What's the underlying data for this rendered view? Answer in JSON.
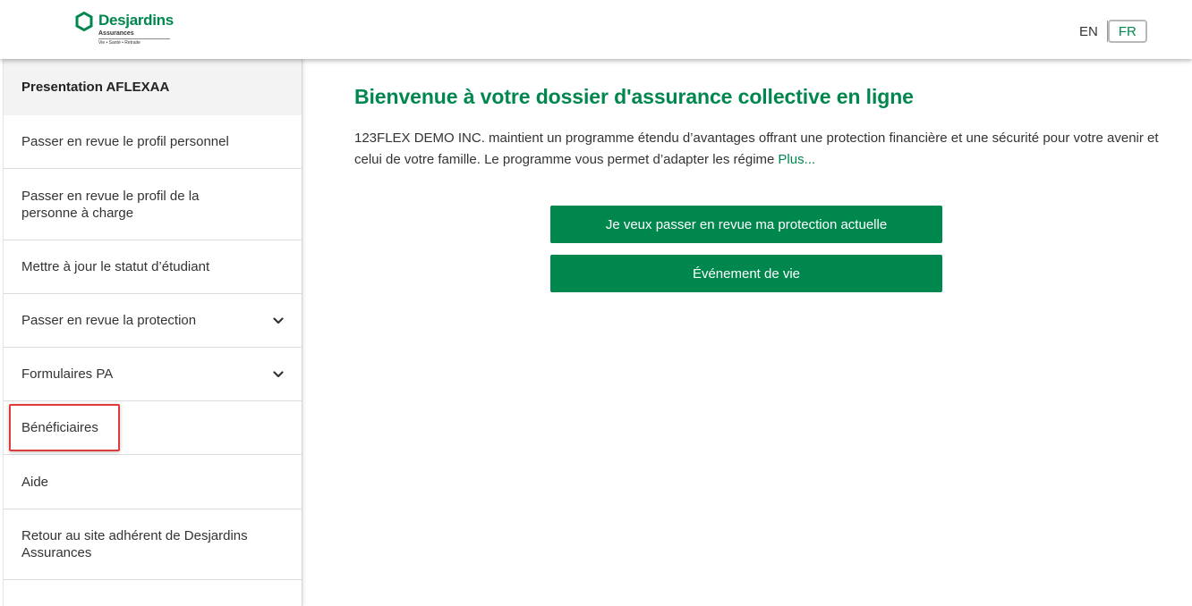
{
  "header": {
    "logo": {
      "name": "Desjardins",
      "subtitle": "Assurances",
      "tagline": "Vie • Santé • Retraite"
    },
    "language": {
      "en_label": "EN",
      "fr_label": "FR",
      "selected": "FR"
    }
  },
  "sidebar": {
    "items": [
      {
        "label": "Presentation AFLEXAA",
        "active": true
      },
      {
        "label": "Passer en revue le profil personnel"
      },
      {
        "label": "Passer en revue le profil de la personne à charge"
      },
      {
        "label": "Mettre à jour le statut d’étudiant"
      },
      {
        "label": "Passer en revue la protection",
        "icon": "chevron-down-icon"
      },
      {
        "label": "Formulaires PA",
        "icon": "chevron-down-icon"
      },
      {
        "label": "Bénéficiaires",
        "highlighted": true
      },
      {
        "label": "Aide"
      },
      {
        "label": "Retour au site adhérent de Desjardins Assurances"
      }
    ]
  },
  "main": {
    "title": "Bienvenue à votre dossier d'assurance collective en ligne",
    "intro": "123FLEX DEMO INC. maintient un programme étendu d’avantages offrant une protection financière et une sécurité pour votre avenir et celui de votre famille. Le programme vous permet d’adapter les régime",
    "more_link": "Plus...",
    "buttons": {
      "review_protection": "Je veux passer en revue ma protection actuelle",
      "life_event": "Événement de vie"
    }
  },
  "colors": {
    "brand_green": "#00874e",
    "highlight_red": "#e03a3a",
    "active_item_bg": "#f3f3f3"
  }
}
